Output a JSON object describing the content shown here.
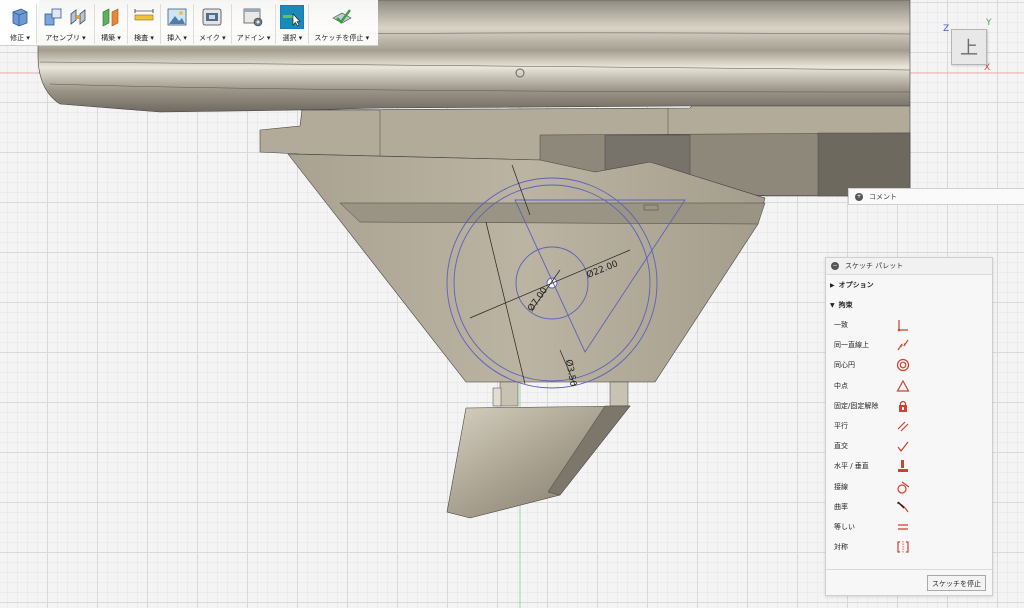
{
  "toolbar": {
    "groups": [
      {
        "id": "modify",
        "label": "修正 ▾"
      },
      {
        "id": "assemble",
        "label": "アセンブリ ▾"
      },
      {
        "id": "construct",
        "label": "構築 ▾"
      },
      {
        "id": "inspect",
        "label": "検査 ▾"
      },
      {
        "id": "insert",
        "label": "挿入 ▾"
      },
      {
        "id": "make",
        "label": "メイク ▾"
      },
      {
        "id": "addins",
        "label": "アドイン ▾"
      },
      {
        "id": "select",
        "label": "選択 ▾"
      },
      {
        "id": "stop-sketch",
        "label": "スケッチを停止 ▾"
      }
    ]
  },
  "viewcube": {
    "face_glyph": "上",
    "axis_z": "Z",
    "axis_y": "Y",
    "axis_x": "X"
  },
  "comment": {
    "button_glyph": "+",
    "label": "コメント"
  },
  "dimensions": {
    "outer_diameter": "Ø22.00",
    "inner_diameter": "Ø7.00",
    "small_diameter": "Ø3.50"
  },
  "palette": {
    "collapse_glyph": "−",
    "title": "スケッチ パレット",
    "options_label": "オプション",
    "constraints_label": "拘束",
    "constraints": [
      {
        "label": "一致",
        "icon": "coincident-icon"
      },
      {
        "label": "同一直線上",
        "icon": "collinear-icon"
      },
      {
        "label": "同心円",
        "icon": "concentric-icon"
      },
      {
        "label": "中点",
        "icon": "midpoint-icon"
      },
      {
        "label": "固定/固定解除",
        "icon": "fix-lock-icon"
      },
      {
        "label": "平行",
        "icon": "parallel-icon"
      },
      {
        "label": "直交",
        "icon": "perpendicular-icon"
      },
      {
        "label": "水平 / 垂直",
        "icon": "horizontal-vertical-icon"
      },
      {
        "label": "接線",
        "icon": "tangent-icon"
      },
      {
        "label": "曲率",
        "icon": "curvature-icon"
      },
      {
        "label": "等しい",
        "icon": "equal-icon"
      },
      {
        "label": "対称",
        "icon": "symmetry-icon"
      }
    ],
    "stop_button": "スケッチを停止"
  },
  "colors": {
    "icon_red": "#d2402f",
    "sketch_blue": "#5a63b8",
    "model_tan": "#b3ab99",
    "select_highlight": "#1a76c4"
  }
}
